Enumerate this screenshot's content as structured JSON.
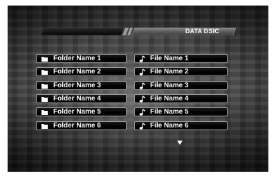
{
  "header": {
    "title": "DATA DSIC"
  },
  "folders": [
    {
      "label": "Folder Name 1",
      "icon": "folder-icon"
    },
    {
      "label": "Folder Name 2",
      "icon": "folder-icon"
    },
    {
      "label": "Folder Name 3",
      "icon": "folder-icon"
    },
    {
      "label": "Folder Name 4",
      "icon": "folder-icon"
    },
    {
      "label": "Folder Name 5",
      "icon": "folder-icon"
    },
    {
      "label": "Folder Name 6",
      "icon": "folder-icon"
    }
  ],
  "files": [
    {
      "label": "File Name 1",
      "icon": "music-note-icon"
    },
    {
      "label": "File Name 2",
      "icon": "music-note-icon"
    },
    {
      "label": "File Name 3",
      "icon": "music-note-icon"
    },
    {
      "label": "File Name 4",
      "icon": "music-note-icon"
    },
    {
      "label": "File Name 5",
      "icon": "music-note-icon"
    },
    {
      "label": "File Name 6",
      "icon": "music-note-icon"
    }
  ],
  "scroll": {
    "icon": "scroll-down-arrow-icon"
  },
  "colors": {
    "text": "#ffffff",
    "button_bg": "#000000",
    "button_border": "#9a9a9a",
    "header_bar": "#6a6a6a"
  }
}
